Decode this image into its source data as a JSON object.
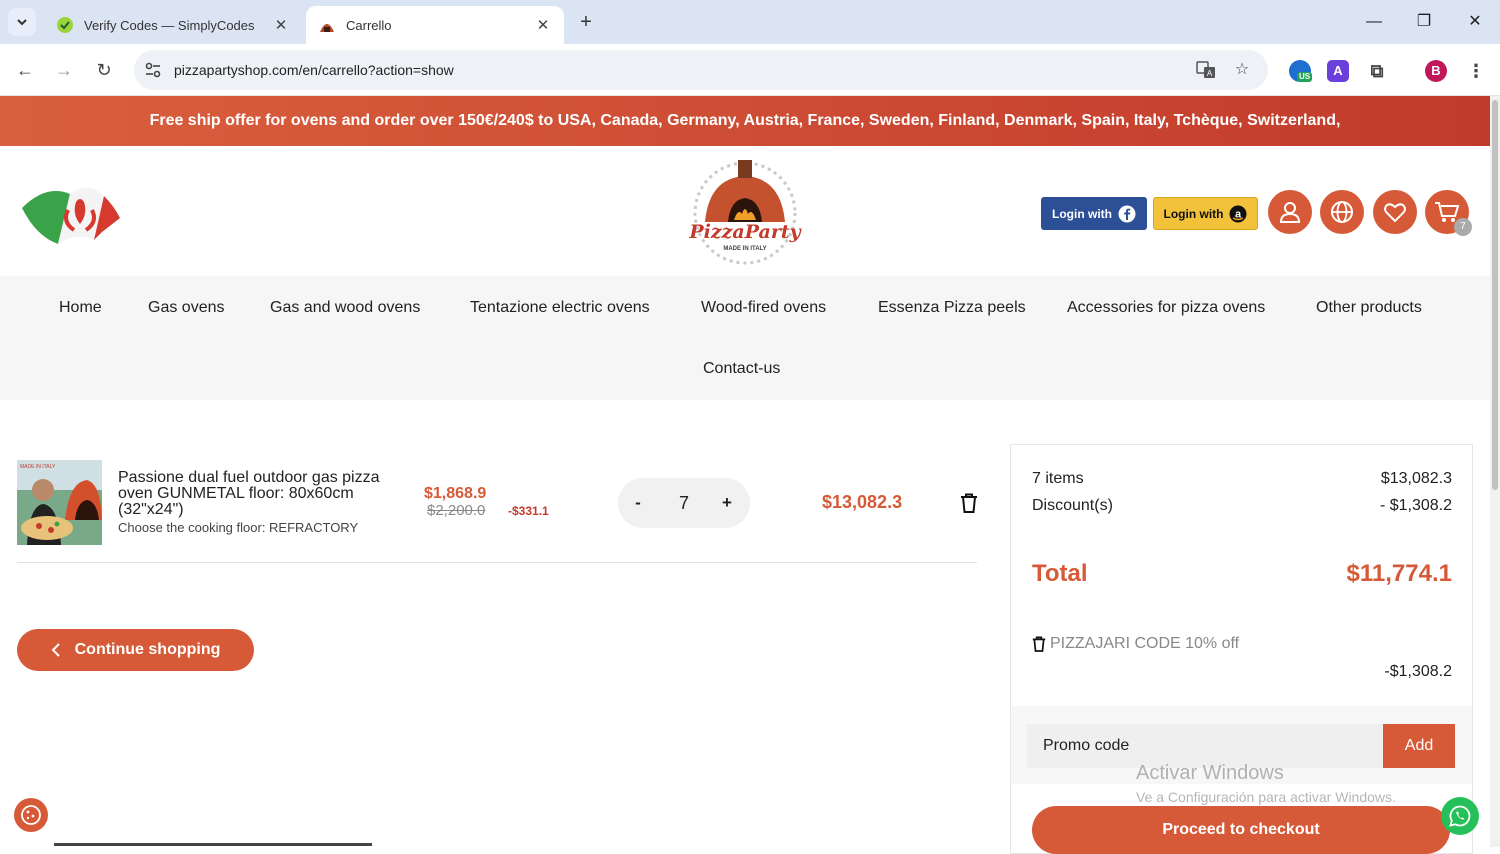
{
  "browser": {
    "tabs": [
      {
        "title": "Verify Codes — SimplyCodes",
        "active": false
      },
      {
        "title": "Carrello",
        "active": true
      }
    ],
    "url": "pizzapartyshop.com/en/carrello?action=show",
    "profile_initial": "B",
    "extension_badge": "US"
  },
  "banner": {
    "text": "Free ship offer for ovens and order over 150€/240$ to USA, Canada, Germany, Austria, France, Sweden, Finland, Denmark, Spain, Italy, Tchèque, Switzerland,"
  },
  "header": {
    "logo_text": "PizzaParty",
    "logo_tagline": "MADE IN ITALY",
    "login_facebook": "Login with",
    "login_amazon": "Login with",
    "cart_count": "7"
  },
  "menu": {
    "items": [
      "Home",
      "Gas ovens",
      "Gas and wood ovens",
      "Tentazione electric ovens",
      "Wood-fired ovens",
      "Essenza Pizza peels",
      "Accessories for pizza ovens",
      "Other products",
      "Contact-us"
    ]
  },
  "cart": {
    "item": {
      "name": "Passione dual fuel outdoor gas pizza oven GUNMETAL floor: 80x60cm (32\"x24\")",
      "option": "Choose the cooking floor: REFRACTORY",
      "image_label": "MADE IN ITALY",
      "price": "$1,868.9",
      "old_price": "$2,200.0",
      "discount": "-$331.1",
      "quantity": "7",
      "qty_minus": "-",
      "qty_plus": "+",
      "line_total": "$13,082.3"
    },
    "continue_label": "Continue shopping"
  },
  "summary": {
    "items_label": "7 items",
    "items_value": "$13,082.3",
    "discount_label": "Discount(s)",
    "discount_value": "- $1,308.2",
    "total_label": "Total",
    "total_value": "$11,774.1",
    "voucher_name": "PIZZAJARI CODE 10% off",
    "voucher_value": "-$1,308.2",
    "promo_placeholder": "Promo code",
    "promo_add": "Add",
    "checkout_label": "Proceed to checkout"
  },
  "os_watermark": {
    "title": "Activar Windows",
    "subtitle": "Ve a Configuración para activar Windows."
  },
  "colors": {
    "accent": "#d65a37",
    "banner_start": "#d9603e",
    "banner_end": "#c23a2b",
    "facebook": "#2d4f95",
    "amazon": "#f2c23b",
    "whatsapp": "#25c05a"
  }
}
